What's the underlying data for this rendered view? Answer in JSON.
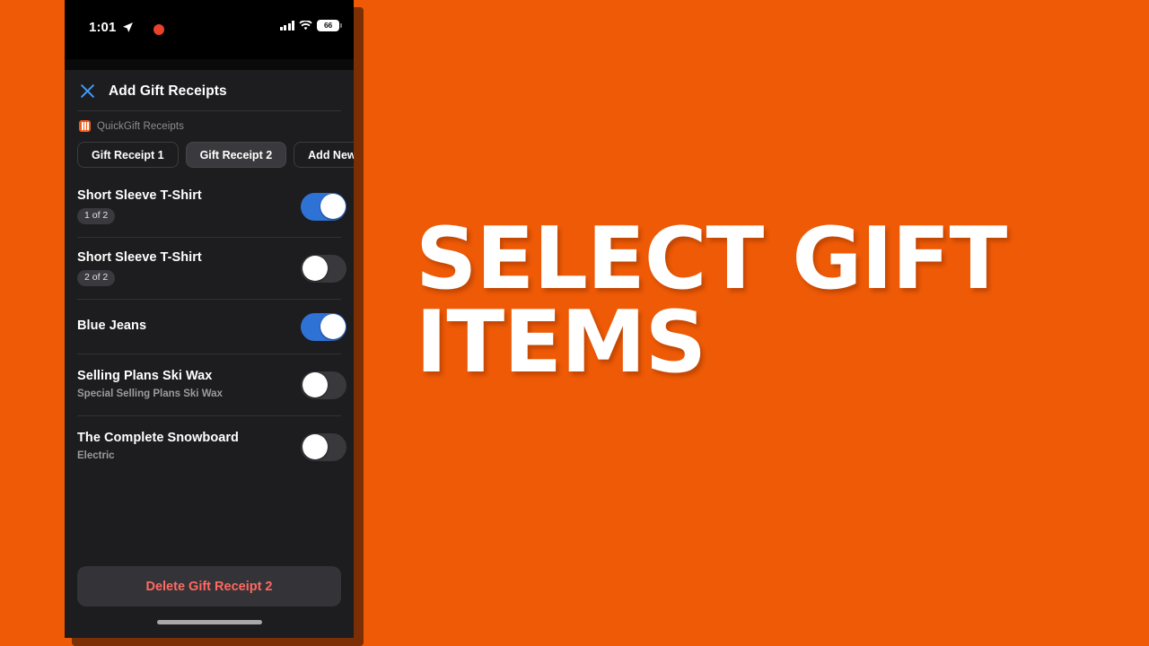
{
  "theme": {
    "background_orange": "#ee5a06",
    "panel_dark": "#1d1d1f",
    "accent_blue": "#3e9bfb",
    "switch_on": "#2f72d6",
    "destructive_red": "#ff6961",
    "brand_orange": "#f25c19"
  },
  "status_bar": {
    "time": "1:01",
    "location_icon": "location-arrow-icon",
    "recording_indicator": "recording-dot-icon",
    "cellular_icon": "cellular-bars-icon",
    "wifi_icon": "wifi-icon",
    "battery_level": "66"
  },
  "nav": {
    "close_icon": "close-x-icon",
    "title": "Add Gift Receipts"
  },
  "section": {
    "app_icon": "quickgift-app-icon",
    "label": "QuickGift Receipts"
  },
  "chips": [
    {
      "label": "Gift Receipt 1",
      "selected": false
    },
    {
      "label": "Gift Receipt 2",
      "selected": true
    },
    {
      "label": "Add New Re",
      "selected": false
    }
  ],
  "items": [
    {
      "title": "Short Sleeve T-Shirt",
      "pill": "1 of 2",
      "subtitle": "",
      "toggle_on": true
    },
    {
      "title": "Short Sleeve T-Shirt",
      "pill": "2 of 2",
      "subtitle": "",
      "toggle_on": false
    },
    {
      "title": "Blue Jeans",
      "pill": "",
      "subtitle": "",
      "toggle_on": true
    },
    {
      "title": "Selling Plans Ski Wax",
      "pill": "",
      "subtitle": "Special Selling Plans Ski Wax",
      "toggle_on": false
    },
    {
      "title": "The Complete Snowboard",
      "pill": "",
      "subtitle": "Electric",
      "toggle_on": false
    }
  ],
  "footer": {
    "delete_label": "Delete Gift Receipt 2",
    "home_indicator": "home-indicator"
  },
  "headline": {
    "line1": "SELECT GIFT",
    "line2": "ITEMS"
  }
}
